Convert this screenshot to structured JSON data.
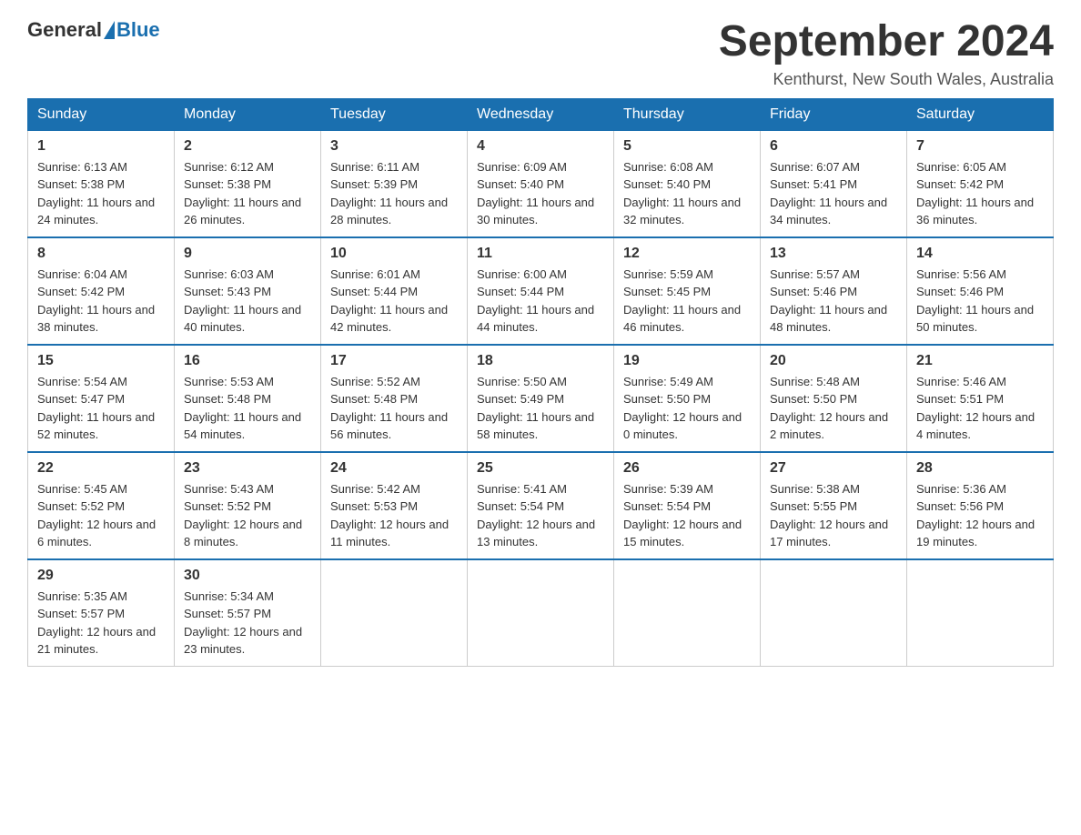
{
  "header": {
    "logo_general": "General",
    "logo_blue": "Blue",
    "title": "September 2024",
    "subtitle": "Kenthurst, New South Wales, Australia"
  },
  "days_of_week": [
    "Sunday",
    "Monday",
    "Tuesday",
    "Wednesday",
    "Thursday",
    "Friday",
    "Saturday"
  ],
  "weeks": [
    [
      {
        "day": "1",
        "sunrise": "6:13 AM",
        "sunset": "5:38 PM",
        "daylight": "11 hours and 24 minutes."
      },
      {
        "day": "2",
        "sunrise": "6:12 AM",
        "sunset": "5:38 PM",
        "daylight": "11 hours and 26 minutes."
      },
      {
        "day": "3",
        "sunrise": "6:11 AM",
        "sunset": "5:39 PM",
        "daylight": "11 hours and 28 minutes."
      },
      {
        "day": "4",
        "sunrise": "6:09 AM",
        "sunset": "5:40 PM",
        "daylight": "11 hours and 30 minutes."
      },
      {
        "day": "5",
        "sunrise": "6:08 AM",
        "sunset": "5:40 PM",
        "daylight": "11 hours and 32 minutes."
      },
      {
        "day": "6",
        "sunrise": "6:07 AM",
        "sunset": "5:41 PM",
        "daylight": "11 hours and 34 minutes."
      },
      {
        "day": "7",
        "sunrise": "6:05 AM",
        "sunset": "5:42 PM",
        "daylight": "11 hours and 36 minutes."
      }
    ],
    [
      {
        "day": "8",
        "sunrise": "6:04 AM",
        "sunset": "5:42 PM",
        "daylight": "11 hours and 38 minutes."
      },
      {
        "day": "9",
        "sunrise": "6:03 AM",
        "sunset": "5:43 PM",
        "daylight": "11 hours and 40 minutes."
      },
      {
        "day": "10",
        "sunrise": "6:01 AM",
        "sunset": "5:44 PM",
        "daylight": "11 hours and 42 minutes."
      },
      {
        "day": "11",
        "sunrise": "6:00 AM",
        "sunset": "5:44 PM",
        "daylight": "11 hours and 44 minutes."
      },
      {
        "day": "12",
        "sunrise": "5:59 AM",
        "sunset": "5:45 PM",
        "daylight": "11 hours and 46 minutes."
      },
      {
        "day": "13",
        "sunrise": "5:57 AM",
        "sunset": "5:46 PM",
        "daylight": "11 hours and 48 minutes."
      },
      {
        "day": "14",
        "sunrise": "5:56 AM",
        "sunset": "5:46 PM",
        "daylight": "11 hours and 50 minutes."
      }
    ],
    [
      {
        "day": "15",
        "sunrise": "5:54 AM",
        "sunset": "5:47 PM",
        "daylight": "11 hours and 52 minutes."
      },
      {
        "day": "16",
        "sunrise": "5:53 AM",
        "sunset": "5:48 PM",
        "daylight": "11 hours and 54 minutes."
      },
      {
        "day": "17",
        "sunrise": "5:52 AM",
        "sunset": "5:48 PM",
        "daylight": "11 hours and 56 minutes."
      },
      {
        "day": "18",
        "sunrise": "5:50 AM",
        "sunset": "5:49 PM",
        "daylight": "11 hours and 58 minutes."
      },
      {
        "day": "19",
        "sunrise": "5:49 AM",
        "sunset": "5:50 PM",
        "daylight": "12 hours and 0 minutes."
      },
      {
        "day": "20",
        "sunrise": "5:48 AM",
        "sunset": "5:50 PM",
        "daylight": "12 hours and 2 minutes."
      },
      {
        "day": "21",
        "sunrise": "5:46 AM",
        "sunset": "5:51 PM",
        "daylight": "12 hours and 4 minutes."
      }
    ],
    [
      {
        "day": "22",
        "sunrise": "5:45 AM",
        "sunset": "5:52 PM",
        "daylight": "12 hours and 6 minutes."
      },
      {
        "day": "23",
        "sunrise": "5:43 AM",
        "sunset": "5:52 PM",
        "daylight": "12 hours and 8 minutes."
      },
      {
        "day": "24",
        "sunrise": "5:42 AM",
        "sunset": "5:53 PM",
        "daylight": "12 hours and 11 minutes."
      },
      {
        "day": "25",
        "sunrise": "5:41 AM",
        "sunset": "5:54 PM",
        "daylight": "12 hours and 13 minutes."
      },
      {
        "day": "26",
        "sunrise": "5:39 AM",
        "sunset": "5:54 PM",
        "daylight": "12 hours and 15 minutes."
      },
      {
        "day": "27",
        "sunrise": "5:38 AM",
        "sunset": "5:55 PM",
        "daylight": "12 hours and 17 minutes."
      },
      {
        "day": "28",
        "sunrise": "5:36 AM",
        "sunset": "5:56 PM",
        "daylight": "12 hours and 19 minutes."
      }
    ],
    [
      {
        "day": "29",
        "sunrise": "5:35 AM",
        "sunset": "5:57 PM",
        "daylight": "12 hours and 21 minutes."
      },
      {
        "day": "30",
        "sunrise": "5:34 AM",
        "sunset": "5:57 PM",
        "daylight": "12 hours and 23 minutes."
      },
      null,
      null,
      null,
      null,
      null
    ]
  ]
}
